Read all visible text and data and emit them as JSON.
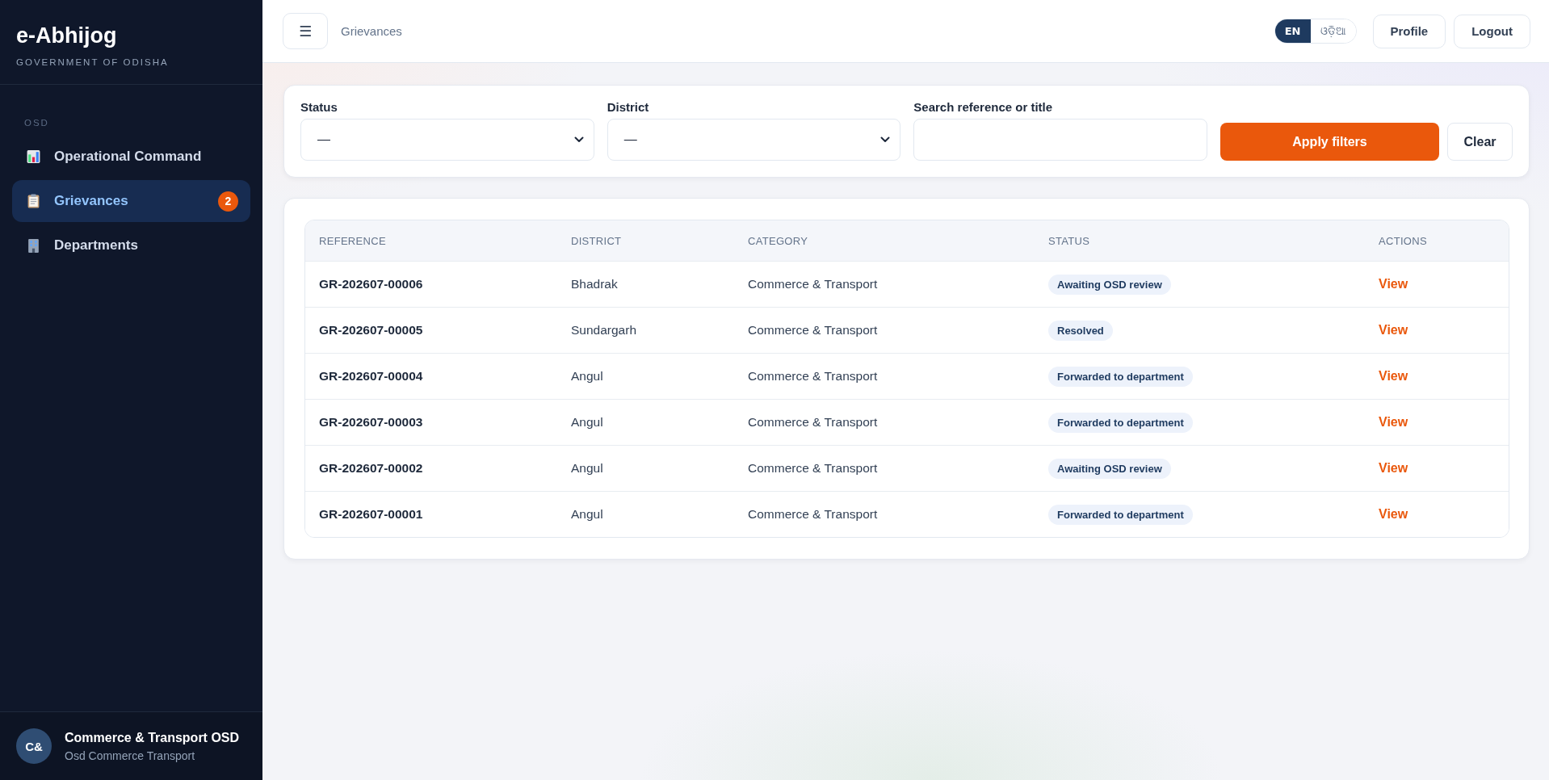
{
  "sidebar": {
    "brand": {
      "title": "e-Abhijog",
      "subtitle": "GOVERNMENT OF ODISHA"
    },
    "section_label": "OSD",
    "items": [
      {
        "label": "Operational Command",
        "selected": false
      },
      {
        "label": "Grievances",
        "selected": true,
        "badge": "2"
      },
      {
        "label": "Departments",
        "selected": false
      }
    ],
    "user": {
      "initials": "C&",
      "name": "Commerce & Transport OSD",
      "role": "Osd Commerce Transport"
    }
  },
  "topbar": {
    "menu_button": "☰",
    "breadcrumb": "Grievances",
    "languages": [
      {
        "label": "EN",
        "selected": true
      },
      {
        "label": "ଓଡ଼ିଆ",
        "selected": false
      }
    ],
    "buttons": [
      "Profile",
      "Logout"
    ]
  },
  "filters": {
    "fields": [
      {
        "kind": "select",
        "label": "Status",
        "value": "—"
      },
      {
        "kind": "select",
        "label": "District",
        "value": "—"
      },
      {
        "kind": "text",
        "label": "Search reference or title"
      }
    ],
    "apply_button": "Apply filters",
    "clear_button": "Clear"
  },
  "table": {
    "columns": [
      "REFERENCE",
      "DISTRICT",
      "CATEGORY",
      "STATUS",
      "ACTIONS"
    ],
    "rows": [
      {
        "reference": "GR-202607-00006",
        "district": "Bhadrak",
        "category": "Commerce & Transport",
        "status": "Awaiting OSD review",
        "action": "View"
      },
      {
        "reference": "GR-202607-00005",
        "district": "Sundargarh",
        "category": "Commerce & Transport",
        "status": "Resolved",
        "action": "View"
      },
      {
        "reference": "GR-202607-00004",
        "district": "Angul",
        "category": "Commerce & Transport",
        "status": "Forwarded to department",
        "action": "View"
      },
      {
        "reference": "GR-202607-00003",
        "district": "Angul",
        "category": "Commerce & Transport",
        "status": "Forwarded to department",
        "action": "View"
      },
      {
        "reference": "GR-202607-00002",
        "district": "Angul",
        "category": "Commerce & Transport",
        "status": "Awaiting OSD review",
        "action": "View"
      },
      {
        "reference": "GR-202607-00001",
        "district": "Angul",
        "category": "Commerce & Transport",
        "status": "Forwarded to department",
        "action": "View"
      }
    ]
  }
}
